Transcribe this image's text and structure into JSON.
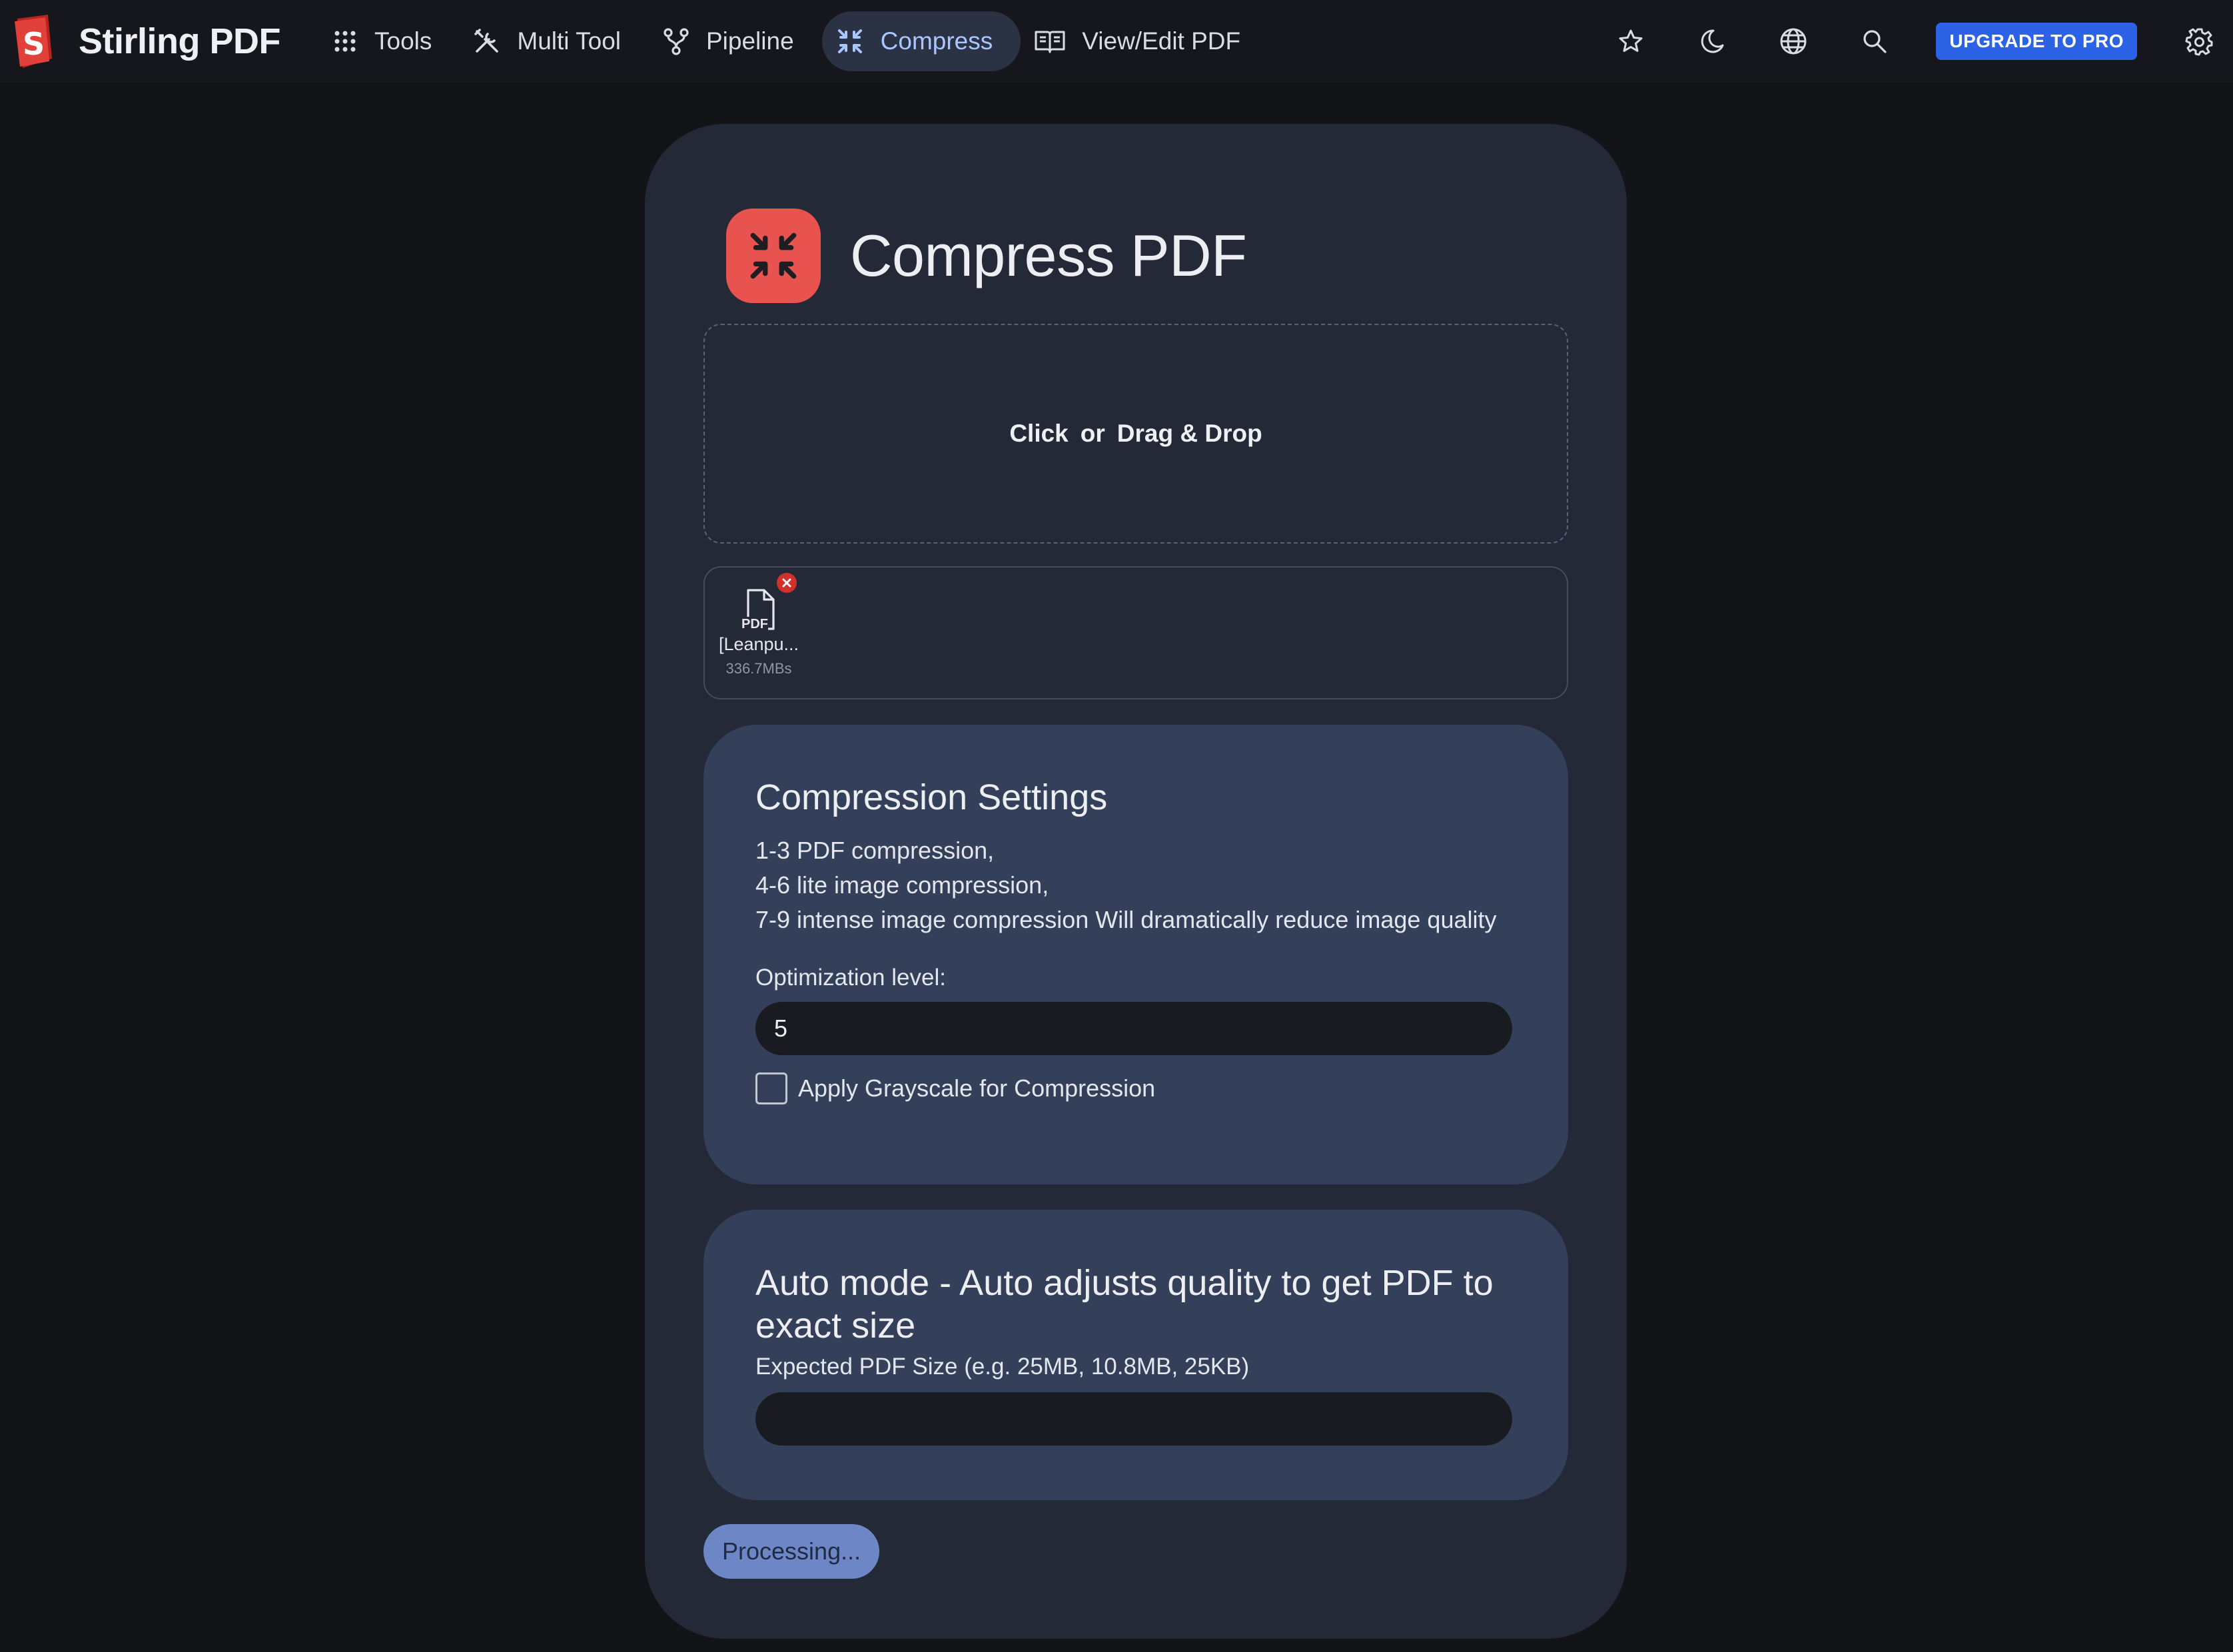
{
  "app": {
    "name": "Stirling PDF",
    "logo_letter": "S"
  },
  "nav": {
    "items": [
      {
        "label": "Tools",
        "icon": "grid-dots-icon",
        "active": false
      },
      {
        "label": "Multi Tool",
        "icon": "tools-icon",
        "active": false
      },
      {
        "label": "Pipeline",
        "icon": "pipeline-icon",
        "active": false
      },
      {
        "label": "Compress",
        "icon": "compress-arrows-icon",
        "active": true
      },
      {
        "label": "View/Edit PDF",
        "icon": "book-open-icon",
        "active": false
      }
    ],
    "right": {
      "favorites_icon": "star-icon",
      "theme_icon": "moon-icon",
      "language_icon": "globe-icon",
      "search_icon": "search-icon",
      "upgrade_label": "UPGRADE TO PRO",
      "settings_icon": "gear-icon"
    }
  },
  "page": {
    "title": "Compress PDF",
    "dropzone": {
      "click_label": "Click",
      "or_label": "or",
      "drag_label": "Drag & Drop"
    },
    "files": [
      {
        "type_label": "PDF",
        "name": "[Leanpu...",
        "size": "336.7MBs"
      }
    ],
    "compression_settings": {
      "title": "Compression Settings",
      "lines": [
        "1-3 PDF compression,",
        "4-6 lite image compression,",
        "7-9 intense image compression Will dramatically reduce image quality"
      ],
      "optimization_label": "Optimization level:",
      "optimization_value": "5",
      "grayscale_label": "Apply Grayscale for Compression",
      "grayscale_checked": false
    },
    "auto_mode": {
      "title": "Auto mode - Auto adjusts quality to get PDF to exact size",
      "size_label": "Expected PDF Size (e.g. 25MB, 10.8MB, 25KB)",
      "size_value": ""
    },
    "submit_label": "Processing..."
  },
  "colors": {
    "background": "#131418",
    "navbar": "#16171c",
    "card": "#232936",
    "panel": "#34405a",
    "accent_active": "#a9c6ff",
    "upgrade_button": "#2c62e6",
    "compress_icon_bg": "#e9534f",
    "remove_badge": "#d2312b",
    "processing_button": "#6c86c6"
  }
}
